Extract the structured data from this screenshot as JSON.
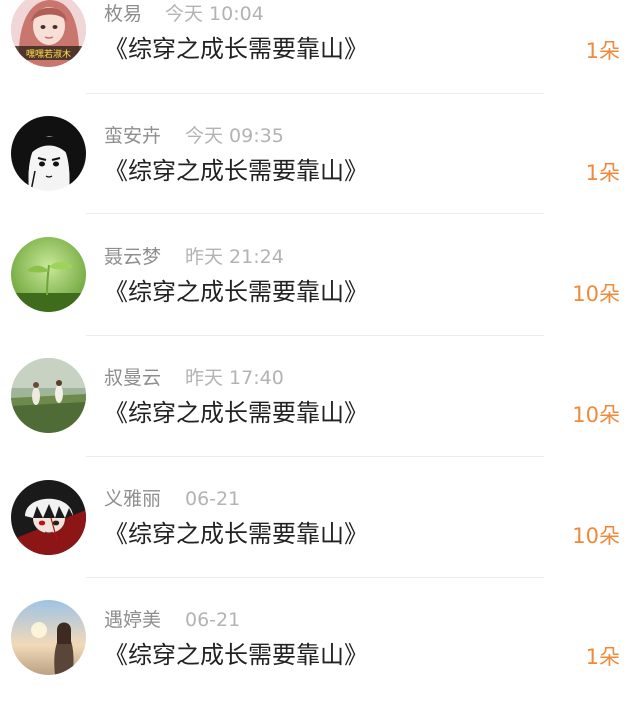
{
  "items": [
    {
      "name": "枚易",
      "time": "今天  10:04",
      "title": "《综穿之成长需要靠山》",
      "count": "1朵",
      "avatar_text": "嘿嘿若淑木"
    },
    {
      "name": "蛮安卉",
      "time": "今天  09:35",
      "title": "《综穿之成长需要靠山》",
      "count": "1朵"
    },
    {
      "name": "聂云梦",
      "time": "昨天  21:24",
      "title": "《综穿之成长需要靠山》",
      "count": "10朵"
    },
    {
      "name": "叔曼云",
      "time": "昨天  17:40",
      "title": "《综穿之成长需要靠山》",
      "count": "10朵"
    },
    {
      "name": "义雅丽",
      "time": "06-21",
      "title": "《综穿之成长需要靠山》",
      "count": "10朵"
    },
    {
      "name": "遇婷美",
      "time": "06-21",
      "title": "《综穿之成长需要靠山》",
      "count": "1朵"
    }
  ],
  "colors": {
    "count": "#f08a3a",
    "name": "#8e8e8e",
    "time": "#b3b3b3",
    "title": "#222222",
    "divider": "#ececec"
  },
  "avatars": [
    "pink-hair-girl-avatar",
    "anime-girl-black-hair-avatar",
    "green-sprout-avatar",
    "girls-running-field-avatar",
    "anime-white-hair-boy-avatar",
    "woman-sunset-avatar"
  ]
}
